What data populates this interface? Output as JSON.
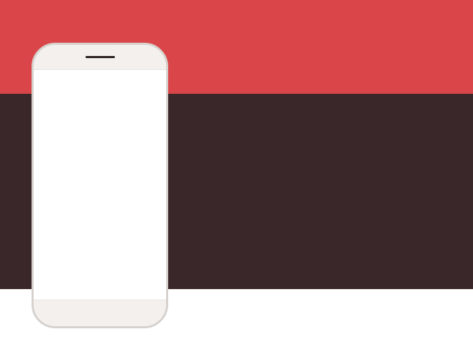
{
  "colors": {
    "band_top": "#d94548",
    "band_middle": "#3a2729",
    "band_bottom": "#ffffff",
    "phone_body": "#f3f0ed",
    "phone_border": "#d7d1cd",
    "phone_screen": "#ffffff",
    "speaker": "#2b1f20"
  }
}
